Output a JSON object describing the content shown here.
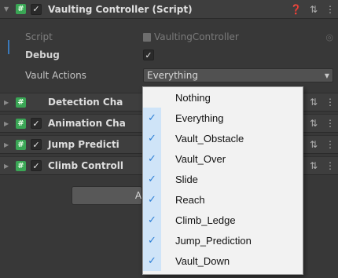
{
  "component": {
    "title": "Vaulting Controller (Script)",
    "help_icon": "help-icon",
    "settings_icon": "preset-icon",
    "menu_icon": "more-menu-icon"
  },
  "fields": {
    "script_label": "Script",
    "script_value": "VaultingController",
    "debug_label": "Debug",
    "vault_actions_label": "Vault Actions",
    "vault_actions_value": "Everything"
  },
  "components": [
    {
      "title": "Detection Cha",
      "enabled": null
    },
    {
      "title": "Animation Cha",
      "enabled": true
    },
    {
      "title": "Jump Predicti",
      "enabled": true
    },
    {
      "title": "Climb Controll",
      "enabled": true
    }
  ],
  "add_button_label": "A",
  "dropdown_options": [
    {
      "label": "Nothing",
      "checked": false
    },
    {
      "label": "Everything",
      "checked": true
    },
    {
      "label": "Vault_Obstacle",
      "checked": true
    },
    {
      "label": "Vault_Over",
      "checked": true
    },
    {
      "label": "Slide",
      "checked": true
    },
    {
      "label": "Reach",
      "checked": true
    },
    {
      "label": "Climb_Ledge",
      "checked": true
    },
    {
      "label": "Jump_Prediction",
      "checked": true
    },
    {
      "label": "Vault_Down",
      "checked": true
    }
  ],
  "colors": {
    "panel": "#383838",
    "script_badge": "#3aa655",
    "check_blue": "#2d7fd6",
    "selection_blue": "#3a79bb"
  }
}
